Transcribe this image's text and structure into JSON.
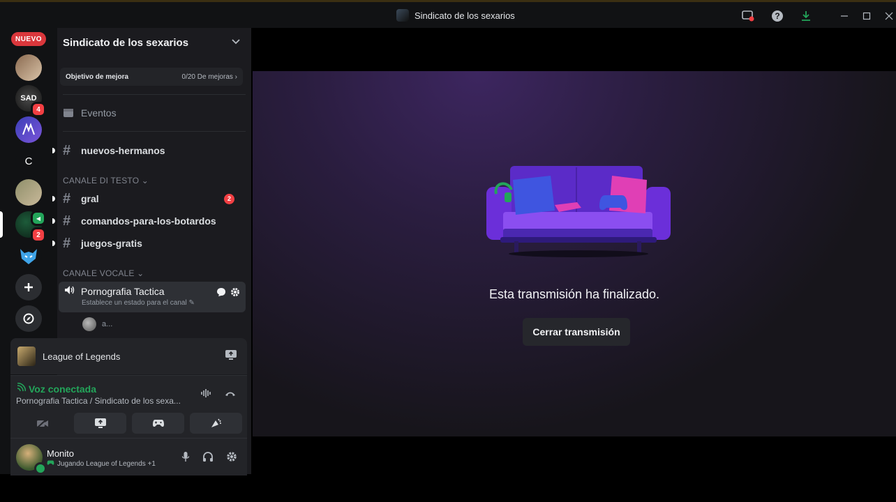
{
  "window": {
    "title": "Sindicato de los sexarios",
    "icons": [
      "screen-share-icon",
      "help-icon",
      "download-icon",
      "minimize-icon",
      "maximize-icon",
      "close-icon"
    ]
  },
  "rail": {
    "new_label": "NUEVO",
    "servers": [
      {
        "initial": "",
        "badge": ""
      },
      {
        "initial": "SAD",
        "badge": "4"
      },
      {
        "initial": "",
        "badge": ""
      },
      {
        "initial": "C",
        "badge": ""
      },
      {
        "initial": "",
        "badge": ""
      },
      {
        "initial": "",
        "badge": "2"
      },
      {
        "initial": "",
        "badge": ""
      }
    ]
  },
  "sidebar": {
    "server_name": "Sindicato de los sexarios",
    "boost": {
      "label": "Objetivo de mejora",
      "progress": "0/20 De mejoras ›"
    },
    "events_label": "Eventos",
    "channels_top": [
      {
        "name": "nuevos-hermanos"
      }
    ],
    "category_text": "CANALE DI TESTO ⌄",
    "text_channels": [
      {
        "name": "gral",
        "badge": "2"
      },
      {
        "name": "comandos-para-los-botardos",
        "badge": ""
      },
      {
        "name": "juegos-gratis",
        "badge": ""
      }
    ],
    "category_voice": "CANALE VOCALE ⌄",
    "voice_channel": {
      "name": "Pornografia Tactica",
      "status": "Establece un estado para el canal ✎"
    },
    "voice_user": "a..."
  },
  "activity": {
    "game": "League of Legends"
  },
  "voice_panel": {
    "status": "Voz conectada",
    "subtitle": "Pornografia Tactica / Sindicato de los sexa..."
  },
  "user_panel": {
    "name": "Monito",
    "status": "Jugando League of Legends +1"
  },
  "main": {
    "message": "Esta transmisión ha finalizado.",
    "close_button": "Cerrar transmisión"
  },
  "colors": {
    "accent_green": "#23a55a",
    "badge_red": "#f23f43",
    "couch_purple": "#6b2fd9"
  }
}
